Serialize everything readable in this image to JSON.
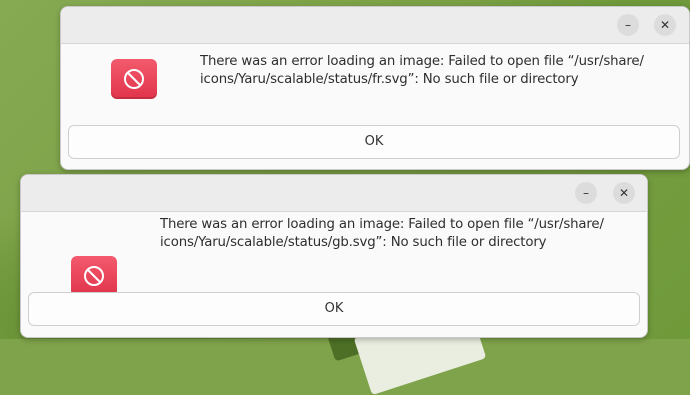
{
  "dialogs": [
    {
      "message_line1": "There was an error loading an image: Failed to open file “/usr/share/",
      "message_line2": "icons/Yaru/scalable/status/fr.svg”: No such file or directory",
      "ok_label": "OK",
      "minimize_glyph": "–",
      "close_glyph": "✕"
    },
    {
      "message_line1": "There was an error loading an image: Failed to open file “/usr/share/",
      "message_line2": "icons/Yaru/scalable/status/gb.svg”: No such file or directory",
      "ok_label": "OK",
      "minimize_glyph": "–",
      "close_glyph": "✕"
    }
  ],
  "icons": {
    "dialog_icon": "error-icon",
    "minimize": "minimize-icon",
    "close": "close-icon"
  },
  "colors": {
    "error_icon": "#e8414f",
    "desktop": "#7fa34a",
    "dialog_bg": "#fafafa",
    "titlebar_bg": "#ececec"
  }
}
